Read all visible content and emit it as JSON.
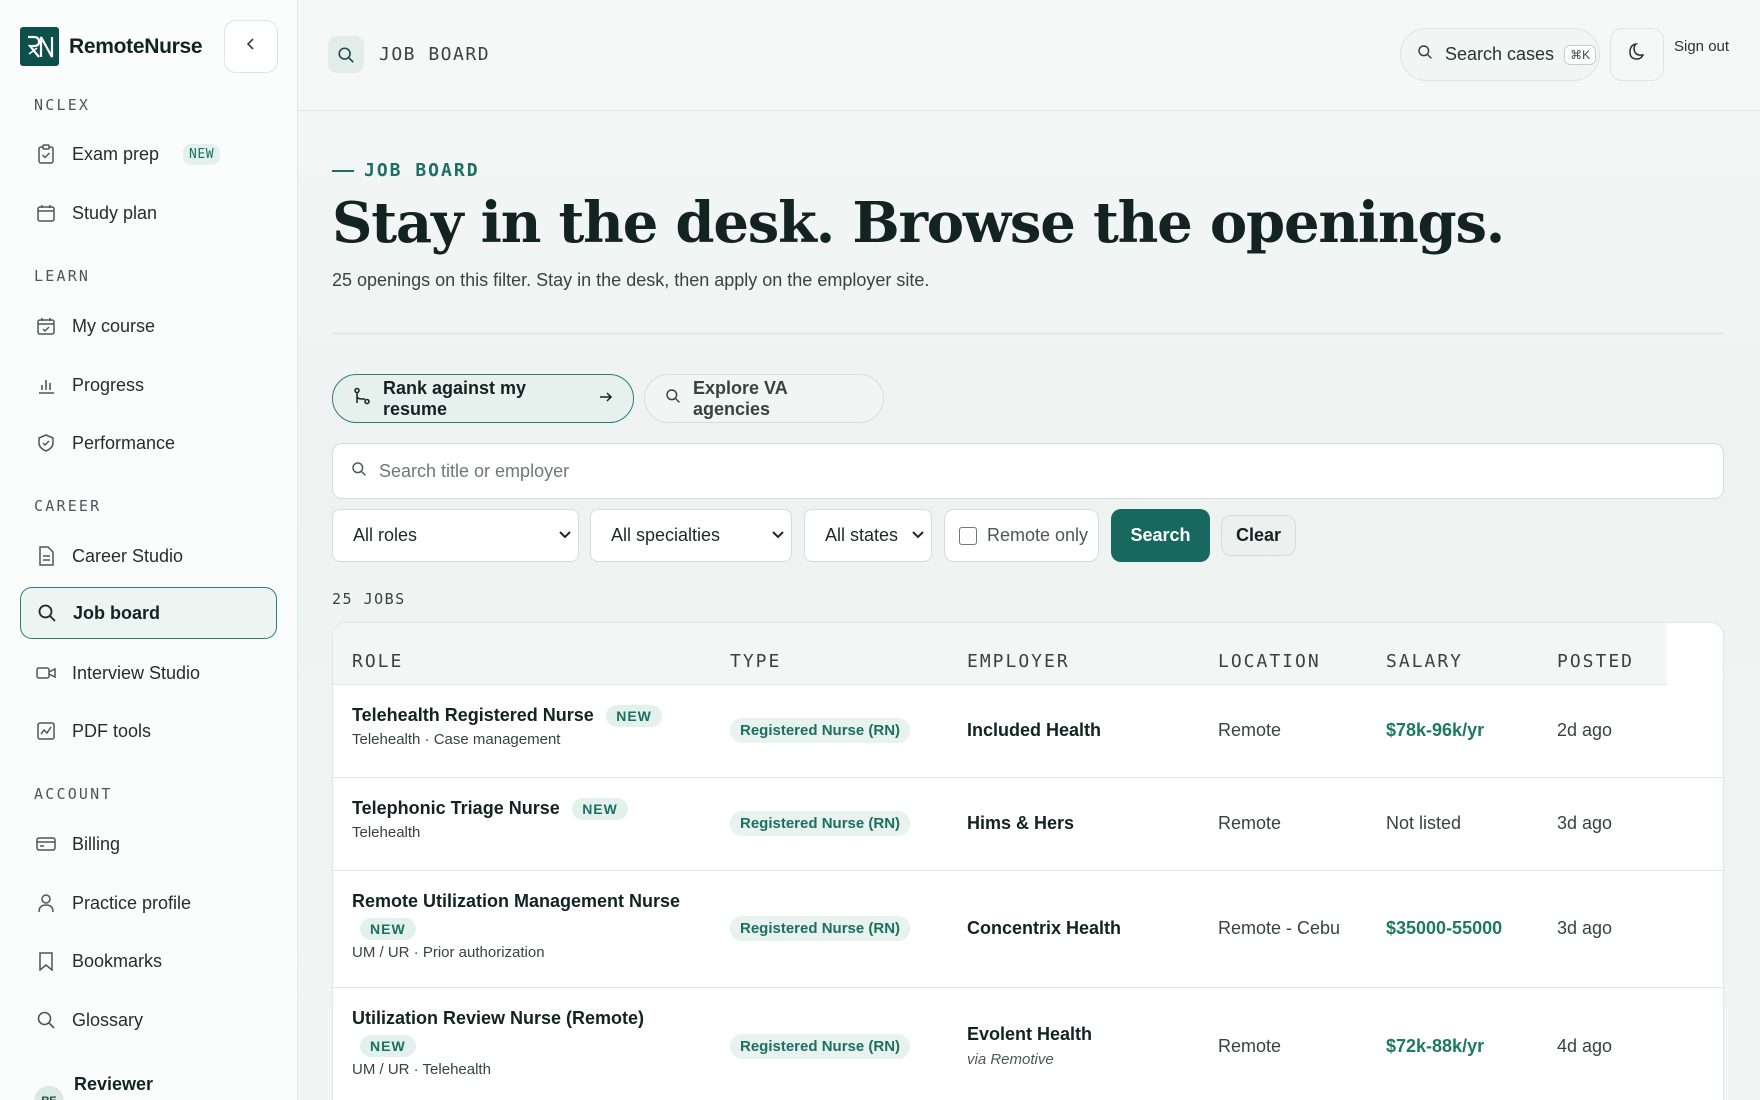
{
  "sidebar": {
    "brand": "RemoteNurse",
    "sections": {
      "nclex": "NCLEX",
      "learn": "LEARN",
      "career": "CAREER",
      "account": "ACCOUNT"
    },
    "items": {
      "exam_prep": "Exam prep",
      "exam_prep_badge": "NEW",
      "study_plan": "Study plan",
      "my_course": "My course",
      "progress": "Progress",
      "performance": "Performance",
      "career_studio": "Career Studio",
      "job_board": "Job board",
      "interview_studio": "Interview Studio",
      "pdf_tools": "PDF tools",
      "billing": "Billing",
      "practice_profile": "Practice profile",
      "bookmarks": "Bookmarks",
      "glossary": "Glossary"
    },
    "user": {
      "initials": "RE",
      "name": "Reviewer"
    }
  },
  "topbar": {
    "breadcrumb": "JOB BOARD",
    "search_label": "Search cases",
    "search_shortcut": "⌘K",
    "sign_out": "Sign out"
  },
  "hero": {
    "eyebrow": "JOB BOARD",
    "title": "Stay in the desk. Browse the openings.",
    "subtitle": "25 openings on this filter. Stay in the desk, then apply on the employer site."
  },
  "actions": {
    "rank": "Rank against my resume",
    "explore": "Explore VA agencies"
  },
  "filters": {
    "search_placeholder": "Search title or employer",
    "roles": "All roles",
    "specialties": "All specialties",
    "states": "All states",
    "remote_only": "Remote only",
    "search_btn": "Search",
    "clear_btn": "Clear"
  },
  "results": {
    "count": "25 JOBS",
    "columns": {
      "role": "ROLE",
      "type": "TYPE",
      "employer": "EMPLOYER",
      "location": "LOCATION",
      "salary": "SALARY",
      "posted": "POSTED"
    },
    "rows": [
      {
        "title": "Telehealth Registered Nurse",
        "badge": "NEW",
        "sub": "Telehealth · Case management",
        "type": "Registered Nurse (RN)",
        "employer": "Included Health",
        "via": "",
        "location": "Remote",
        "salary": "$78k-96k/yr",
        "posted": "2d ago"
      },
      {
        "title": "Telephonic Triage Nurse",
        "badge": "NEW",
        "sub": "Telehealth",
        "type": "Registered Nurse (RN)",
        "employer": "Hims & Hers",
        "via": "",
        "location": "Remote",
        "salary": "Not listed",
        "posted": "3d ago"
      },
      {
        "title": "Remote Utilization Management Nurse",
        "badge": "NEW",
        "sub": "UM / UR · Prior authorization",
        "type": "Registered Nurse (RN)",
        "employer": "Concentrix Health",
        "via": "",
        "location": "Remote - Cebu",
        "salary": "$35000-55000",
        "posted": "3d ago"
      },
      {
        "title": "Utilization Review Nurse (Remote)",
        "badge": "NEW",
        "sub": "UM / UR · Telehealth",
        "type": "Registered Nurse (RN)",
        "employer": "Evolent Health",
        "via": "via Remotive",
        "location": "Remote",
        "salary": "$72k-88k/yr",
        "posted": "4d ago"
      }
    ]
  }
}
